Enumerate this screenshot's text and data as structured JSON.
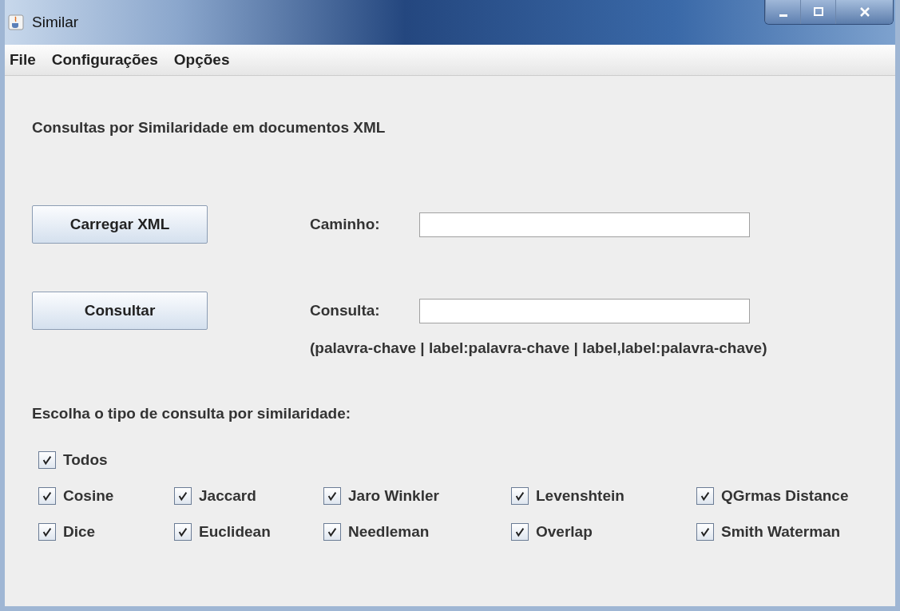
{
  "window": {
    "title": "Similar"
  },
  "menu": [
    "File",
    "Configurações",
    "Opções"
  ],
  "heading": "Consultas por Similaridade em documentos XML",
  "actions": [
    {
      "button": "Carregar XML",
      "label": "Caminho:"
    },
    {
      "button": "Consultar",
      "label": "Consulta:"
    }
  ],
  "hint": "(palavra-chave | label:palavra-chave | label,label:palavra-chave)",
  "choice_label": "Escolha o tipo de consulta por similaridade:",
  "all": {
    "label": "Todos",
    "checked": true
  },
  "options": [
    {
      "label": "Cosine",
      "checked": true
    },
    {
      "label": "Jaccard",
      "checked": true
    },
    {
      "label": "Jaro Winkler",
      "checked": true
    },
    {
      "label": "Levenshtein",
      "checked": true
    },
    {
      "label": "QGrmas Distance",
      "checked": true
    },
    {
      "label": "Dice",
      "checked": true
    },
    {
      "label": "Euclidean",
      "checked": true
    },
    {
      "label": "Needleman",
      "checked": true
    },
    {
      "label": "Overlap",
      "checked": true
    },
    {
      "label": "Smith Waterman",
      "checked": true
    }
  ]
}
